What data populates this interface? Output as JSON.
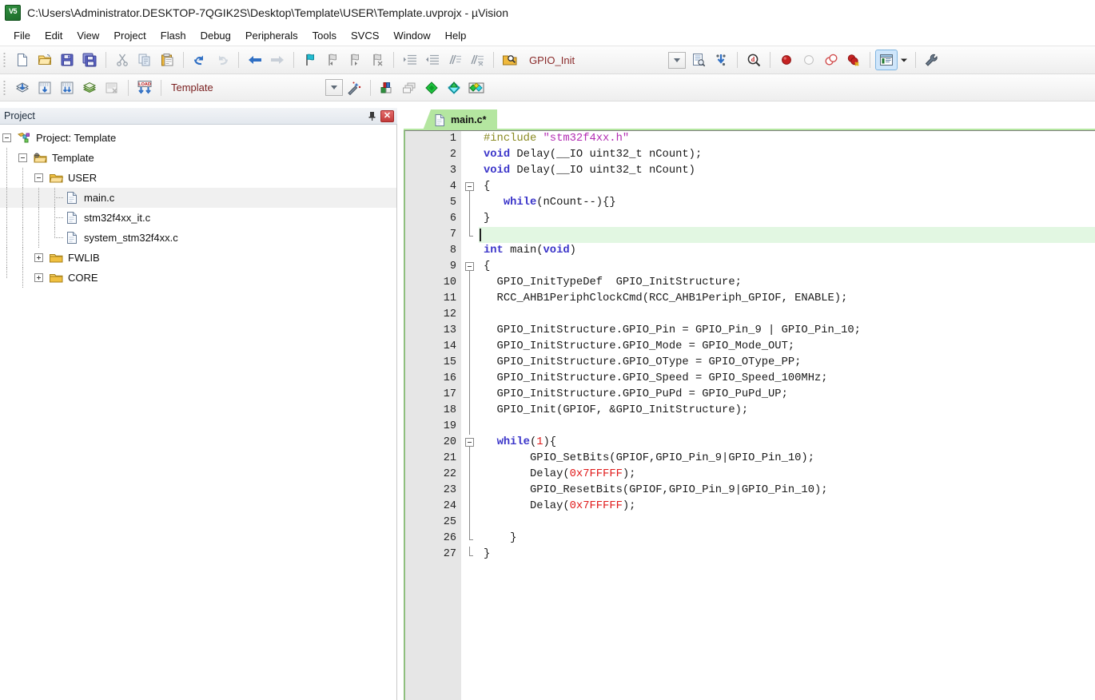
{
  "window": {
    "title": "C:\\Users\\Administrator.DESKTOP-7QGIK2S\\Desktop\\Template\\USER\\Template.uvprojx - µVision",
    "app_icon": "uvision-icon"
  },
  "menubar": {
    "items": [
      {
        "label": "File"
      },
      {
        "label": "Edit"
      },
      {
        "label": "View"
      },
      {
        "label": "Project"
      },
      {
        "label": "Flash"
      },
      {
        "label": "Debug"
      },
      {
        "label": "Peripherals"
      },
      {
        "label": "Tools"
      },
      {
        "label": "SVCS"
      },
      {
        "label": "Window"
      },
      {
        "label": "Help"
      }
    ]
  },
  "toolbar_main": {
    "buttons": [
      {
        "name": "new-file-icon",
        "title": "New"
      },
      {
        "name": "open-file-icon",
        "title": "Open"
      },
      {
        "name": "save-icon",
        "title": "Save"
      },
      {
        "name": "save-all-icon",
        "title": "Save All"
      },
      {
        "name": "cut-icon",
        "title": "Cut"
      },
      {
        "name": "copy-icon",
        "title": "Copy"
      },
      {
        "name": "paste-icon",
        "title": "Paste"
      },
      {
        "name": "undo-icon",
        "title": "Undo"
      },
      {
        "name": "redo-icon",
        "title": "Redo"
      },
      {
        "name": "navigate-back-icon",
        "title": "Back"
      },
      {
        "name": "navigate-forward-icon",
        "title": "Forward"
      },
      {
        "name": "bookmark-toggle-icon",
        "title": "Insert/Remove Bookmark"
      },
      {
        "name": "bookmark-prev-icon",
        "title": "Previous Bookmark"
      },
      {
        "name": "bookmark-next-icon",
        "title": "Next Bookmark"
      },
      {
        "name": "bookmark-clear-icon",
        "title": "Clear All Bookmarks"
      },
      {
        "name": "indent-icon",
        "title": "Indent"
      },
      {
        "name": "outdent-icon",
        "title": "Outdent"
      },
      {
        "name": "comment-icon",
        "title": "Comment"
      },
      {
        "name": "uncomment-icon",
        "title": "Uncomment"
      },
      {
        "name": "find-in-files-icon",
        "title": "Find in Files"
      }
    ],
    "symbol_combo": {
      "value": "GPIO_Init",
      "dropdown_icon": "chevron-down-icon"
    },
    "right_buttons": [
      {
        "name": "source-browse-icon",
        "title": "Source Browse"
      },
      {
        "name": "configure-icon",
        "title": "Configure"
      },
      {
        "name": "find-icon",
        "title": "Find"
      },
      {
        "name": "breakpoint-insert-icon",
        "title": "Insert/Remove Breakpoint"
      },
      {
        "name": "breakpoint-enable-icon",
        "title": "Enable/Disable Breakpoint"
      },
      {
        "name": "breakpoint-disable-all-icon",
        "title": "Disable All Breakpoints"
      },
      {
        "name": "breakpoint-kill-all-icon",
        "title": "Kill All Breakpoints"
      },
      {
        "name": "project-window-icon",
        "title": "Project Window"
      },
      {
        "name": "project-window-dropdown-icon",
        "title": "Window Options"
      },
      {
        "name": "configure-target-icon",
        "title": "Configuration Wizard"
      }
    ]
  },
  "toolbar_build": {
    "buttons": [
      {
        "name": "translate-icon",
        "title": "Translate"
      },
      {
        "name": "build-icon",
        "title": "Build"
      },
      {
        "name": "rebuild-icon",
        "title": "Rebuild"
      },
      {
        "name": "batch-build-icon",
        "title": "Batch Build"
      },
      {
        "name": "stop-build-icon",
        "title": "Stop Build"
      },
      {
        "name": "download-icon",
        "title": "Download"
      }
    ],
    "target_combo": {
      "value": "Template",
      "dropdown_icon": "chevron-down-icon"
    },
    "right_buttons": [
      {
        "name": "magic-wand-icon",
        "title": "Options for Target"
      },
      {
        "name": "manage-project-items-icon",
        "title": "Manage Project Items"
      },
      {
        "name": "multi-project-icon",
        "title": "Manage Multi-Project"
      },
      {
        "name": "target-options-icon",
        "title": "Target Options"
      },
      {
        "name": "pack-installer-icon",
        "title": "Pack Installer"
      },
      {
        "name": "run-to-icon",
        "title": "Manage Run-Time Environment"
      }
    ]
  },
  "project_panel": {
    "title": "Project",
    "pin_icon": "pin-icon",
    "close_icon": "close-icon",
    "tree": [
      {
        "label": "Project: Template",
        "icon": "project-icon",
        "depth": 0,
        "state": "expanded",
        "selected": false
      },
      {
        "label": "Template",
        "icon": "target-icon",
        "depth": 1,
        "state": "expanded",
        "selected": false
      },
      {
        "label": "USER",
        "icon": "folder-open-icon",
        "depth": 2,
        "state": "expanded",
        "selected": false
      },
      {
        "label": "main.c",
        "icon": "c-file-icon",
        "depth": 3,
        "state": "leaf",
        "selected": true
      },
      {
        "label": "stm32f4xx_it.c",
        "icon": "c-file-icon",
        "depth": 3,
        "state": "leaf",
        "selected": false
      },
      {
        "label": "system_stm32f4xx.c",
        "icon": "c-file-icon",
        "depth": 3,
        "state": "leaf",
        "selected": false
      },
      {
        "label": "FWLIB",
        "icon": "folder-icon",
        "depth": 2,
        "state": "collapsed",
        "selected": false
      },
      {
        "label": "CORE",
        "icon": "folder-icon",
        "depth": 2,
        "state": "collapsed",
        "selected": false
      }
    ]
  },
  "editor": {
    "tabs": [
      {
        "label": "main.c*",
        "icon": "c-file-icon",
        "active": true,
        "modified": true
      }
    ],
    "cursor_line": 7,
    "lines": [
      {
        "n": 1,
        "fold": "none",
        "tokens": [
          {
            "t": "#include ",
            "c": "pp"
          },
          {
            "t": "\"stm32f4xx.h\"",
            "c": "str"
          }
        ]
      },
      {
        "n": 2,
        "fold": "none",
        "tokens": [
          {
            "t": "void",
            "c": "kw"
          },
          {
            "t": " Delay(__IO uint32_t nCount);",
            "c": "pun"
          }
        ]
      },
      {
        "n": 3,
        "fold": "none",
        "tokens": [
          {
            "t": "void",
            "c": "kw"
          },
          {
            "t": " Delay(__IO uint32_t nCount)",
            "c": "pun"
          }
        ]
      },
      {
        "n": 4,
        "fold": "start",
        "tokens": [
          {
            "t": "{",
            "c": "pun"
          }
        ]
      },
      {
        "n": 5,
        "fold": "mid",
        "tokens": [
          {
            "t": "   ",
            "c": "pun"
          },
          {
            "t": "while",
            "c": "kw"
          },
          {
            "t": "(nCount--){}",
            "c": "pun"
          }
        ]
      },
      {
        "n": 6,
        "fold": "mid",
        "tokens": [
          {
            "t": "}",
            "c": "pun"
          }
        ]
      },
      {
        "n": 7,
        "fold": "end",
        "tokens": [
          {
            "t": "",
            "c": "pun"
          }
        ]
      },
      {
        "n": 8,
        "fold": "none",
        "tokens": [
          {
            "t": "int",
            "c": "kw"
          },
          {
            "t": " main(",
            "c": "pun"
          },
          {
            "t": "void",
            "c": "kw"
          },
          {
            "t": ")",
            "c": "pun"
          }
        ]
      },
      {
        "n": 9,
        "fold": "start",
        "tokens": [
          {
            "t": "{",
            "c": "pun"
          }
        ]
      },
      {
        "n": 10,
        "fold": "mid",
        "tokens": [
          {
            "t": "  GPIO_InitTypeDef  GPIO_InitStructure;",
            "c": "pun"
          }
        ]
      },
      {
        "n": 11,
        "fold": "mid",
        "tokens": [
          {
            "t": "  RCC_AHB1PeriphClockCmd(RCC_AHB1Periph_GPIOF, ENABLE);",
            "c": "pun"
          }
        ]
      },
      {
        "n": 12,
        "fold": "mid",
        "tokens": [
          {
            "t": "",
            "c": "pun"
          }
        ]
      },
      {
        "n": 13,
        "fold": "mid",
        "tokens": [
          {
            "t": "  GPIO_InitStructure.GPIO_Pin = GPIO_Pin_9 | GPIO_Pin_10;",
            "c": "pun"
          }
        ]
      },
      {
        "n": 14,
        "fold": "mid",
        "tokens": [
          {
            "t": "  GPIO_InitStructure.GPIO_Mode = GPIO_Mode_OUT;",
            "c": "pun"
          }
        ]
      },
      {
        "n": 15,
        "fold": "mid",
        "tokens": [
          {
            "t": "  GPIO_InitStructure.GPIO_OType = GPIO_OType_PP;",
            "c": "pun"
          }
        ]
      },
      {
        "n": 16,
        "fold": "mid",
        "tokens": [
          {
            "t": "  GPIO_InitStructure.GPIO_Speed = GPIO_Speed_100MHz;",
            "c": "pun"
          }
        ]
      },
      {
        "n": 17,
        "fold": "mid",
        "tokens": [
          {
            "t": "  GPIO_InitStructure.GPIO_PuPd = GPIO_PuPd_UP;",
            "c": "pun"
          }
        ]
      },
      {
        "n": 18,
        "fold": "mid",
        "tokens": [
          {
            "t": "  GPIO_Init(GPIOF, &GPIO_InitStructure);",
            "c": "pun"
          }
        ]
      },
      {
        "n": 19,
        "fold": "mid",
        "tokens": [
          {
            "t": "",
            "c": "pun"
          }
        ]
      },
      {
        "n": 20,
        "fold": "start2",
        "tokens": [
          {
            "t": "  ",
            "c": "pun"
          },
          {
            "t": "while",
            "c": "kw"
          },
          {
            "t": "(",
            "c": "pun"
          },
          {
            "t": "1",
            "c": "num"
          },
          {
            "t": "){",
            "c": "pun"
          }
        ]
      },
      {
        "n": 21,
        "fold": "mid2",
        "tokens": [
          {
            "t": "       GPIO_SetBits(GPIOF,GPIO_Pin_9|GPIO_Pin_10);",
            "c": "pun"
          }
        ]
      },
      {
        "n": 22,
        "fold": "mid2",
        "tokens": [
          {
            "t": "       Delay(",
            "c": "pun"
          },
          {
            "t": "0x7FFFFF",
            "c": "num"
          },
          {
            "t": ");",
            "c": "pun"
          }
        ]
      },
      {
        "n": 23,
        "fold": "mid2",
        "tokens": [
          {
            "t": "       GPIO_ResetBits(GPIOF,GPIO_Pin_9|GPIO_Pin_10);",
            "c": "pun"
          }
        ]
      },
      {
        "n": 24,
        "fold": "mid2",
        "tokens": [
          {
            "t": "       Delay(",
            "c": "pun"
          },
          {
            "t": "0x7FFFFF",
            "c": "num"
          },
          {
            "t": ");",
            "c": "pun"
          }
        ]
      },
      {
        "n": 25,
        "fold": "mid2",
        "tokens": [
          {
            "t": "",
            "c": "pun"
          }
        ]
      },
      {
        "n": 26,
        "fold": "end2",
        "tokens": [
          {
            "t": "    }",
            "c": "pun"
          }
        ]
      },
      {
        "n": 27,
        "fold": "end",
        "tokens": [
          {
            "t": "}",
            "c": "pun"
          }
        ]
      }
    ]
  },
  "colors": {
    "tab_active": "#b4e6a0",
    "current_line": "#e2f7e2",
    "gutter": "#e6e6e6",
    "keyword": "#3a34c9",
    "string": "#b32db3",
    "number": "#e01b1b",
    "preprocessor": "#8a8a22",
    "combo_text": "#7a2020",
    "selection": "#f0f0f0"
  }
}
